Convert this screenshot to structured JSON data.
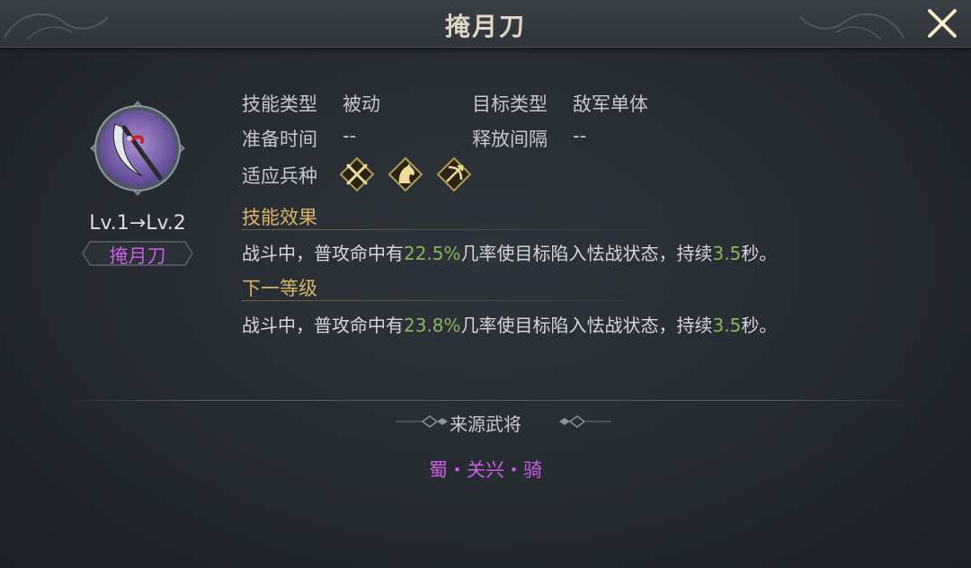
{
  "header": {
    "title": "掩月刀",
    "close_icon": "close-x-icon"
  },
  "skill": {
    "icon": "crescent-blade-icon",
    "level": "Lv.1→Lv.2",
    "name": "掩月刀",
    "name_color": "#c65fe0"
  },
  "attributes": {
    "skill_type_label": "技能类型",
    "skill_type_value": "被动",
    "target_type_label": "目标类型",
    "target_type_value": "敌军单体",
    "prep_time_label": "准备时间",
    "prep_time_value": "--",
    "cooldown_label": "释放间隔",
    "cooldown_value": "--",
    "unit_types_label": "适应兵种",
    "unit_types": [
      "crossed-spears-icon",
      "horse-head-icon",
      "bow-icon"
    ]
  },
  "effect": {
    "heading": "技能效果",
    "pre": "战斗中，普攻命中有",
    "chance": "22.5%",
    "mid": "几率使目标陷入怯战状态，持续",
    "duration": "3.5",
    "post": "秒。"
  },
  "next_level": {
    "heading": "下一等级",
    "pre": "战斗中，普攻命中有",
    "chance": "23.8%",
    "mid": "几率使目标陷入怯战状态，持续",
    "duration": "3.5",
    "post": "秒。"
  },
  "source": {
    "heading": "来源武将",
    "general": "蜀・关兴・骑"
  },
  "colors": {
    "highlight": "#86b85a",
    "section_heading": "#d8b46a",
    "rarity_purple": "#c65fe0"
  }
}
